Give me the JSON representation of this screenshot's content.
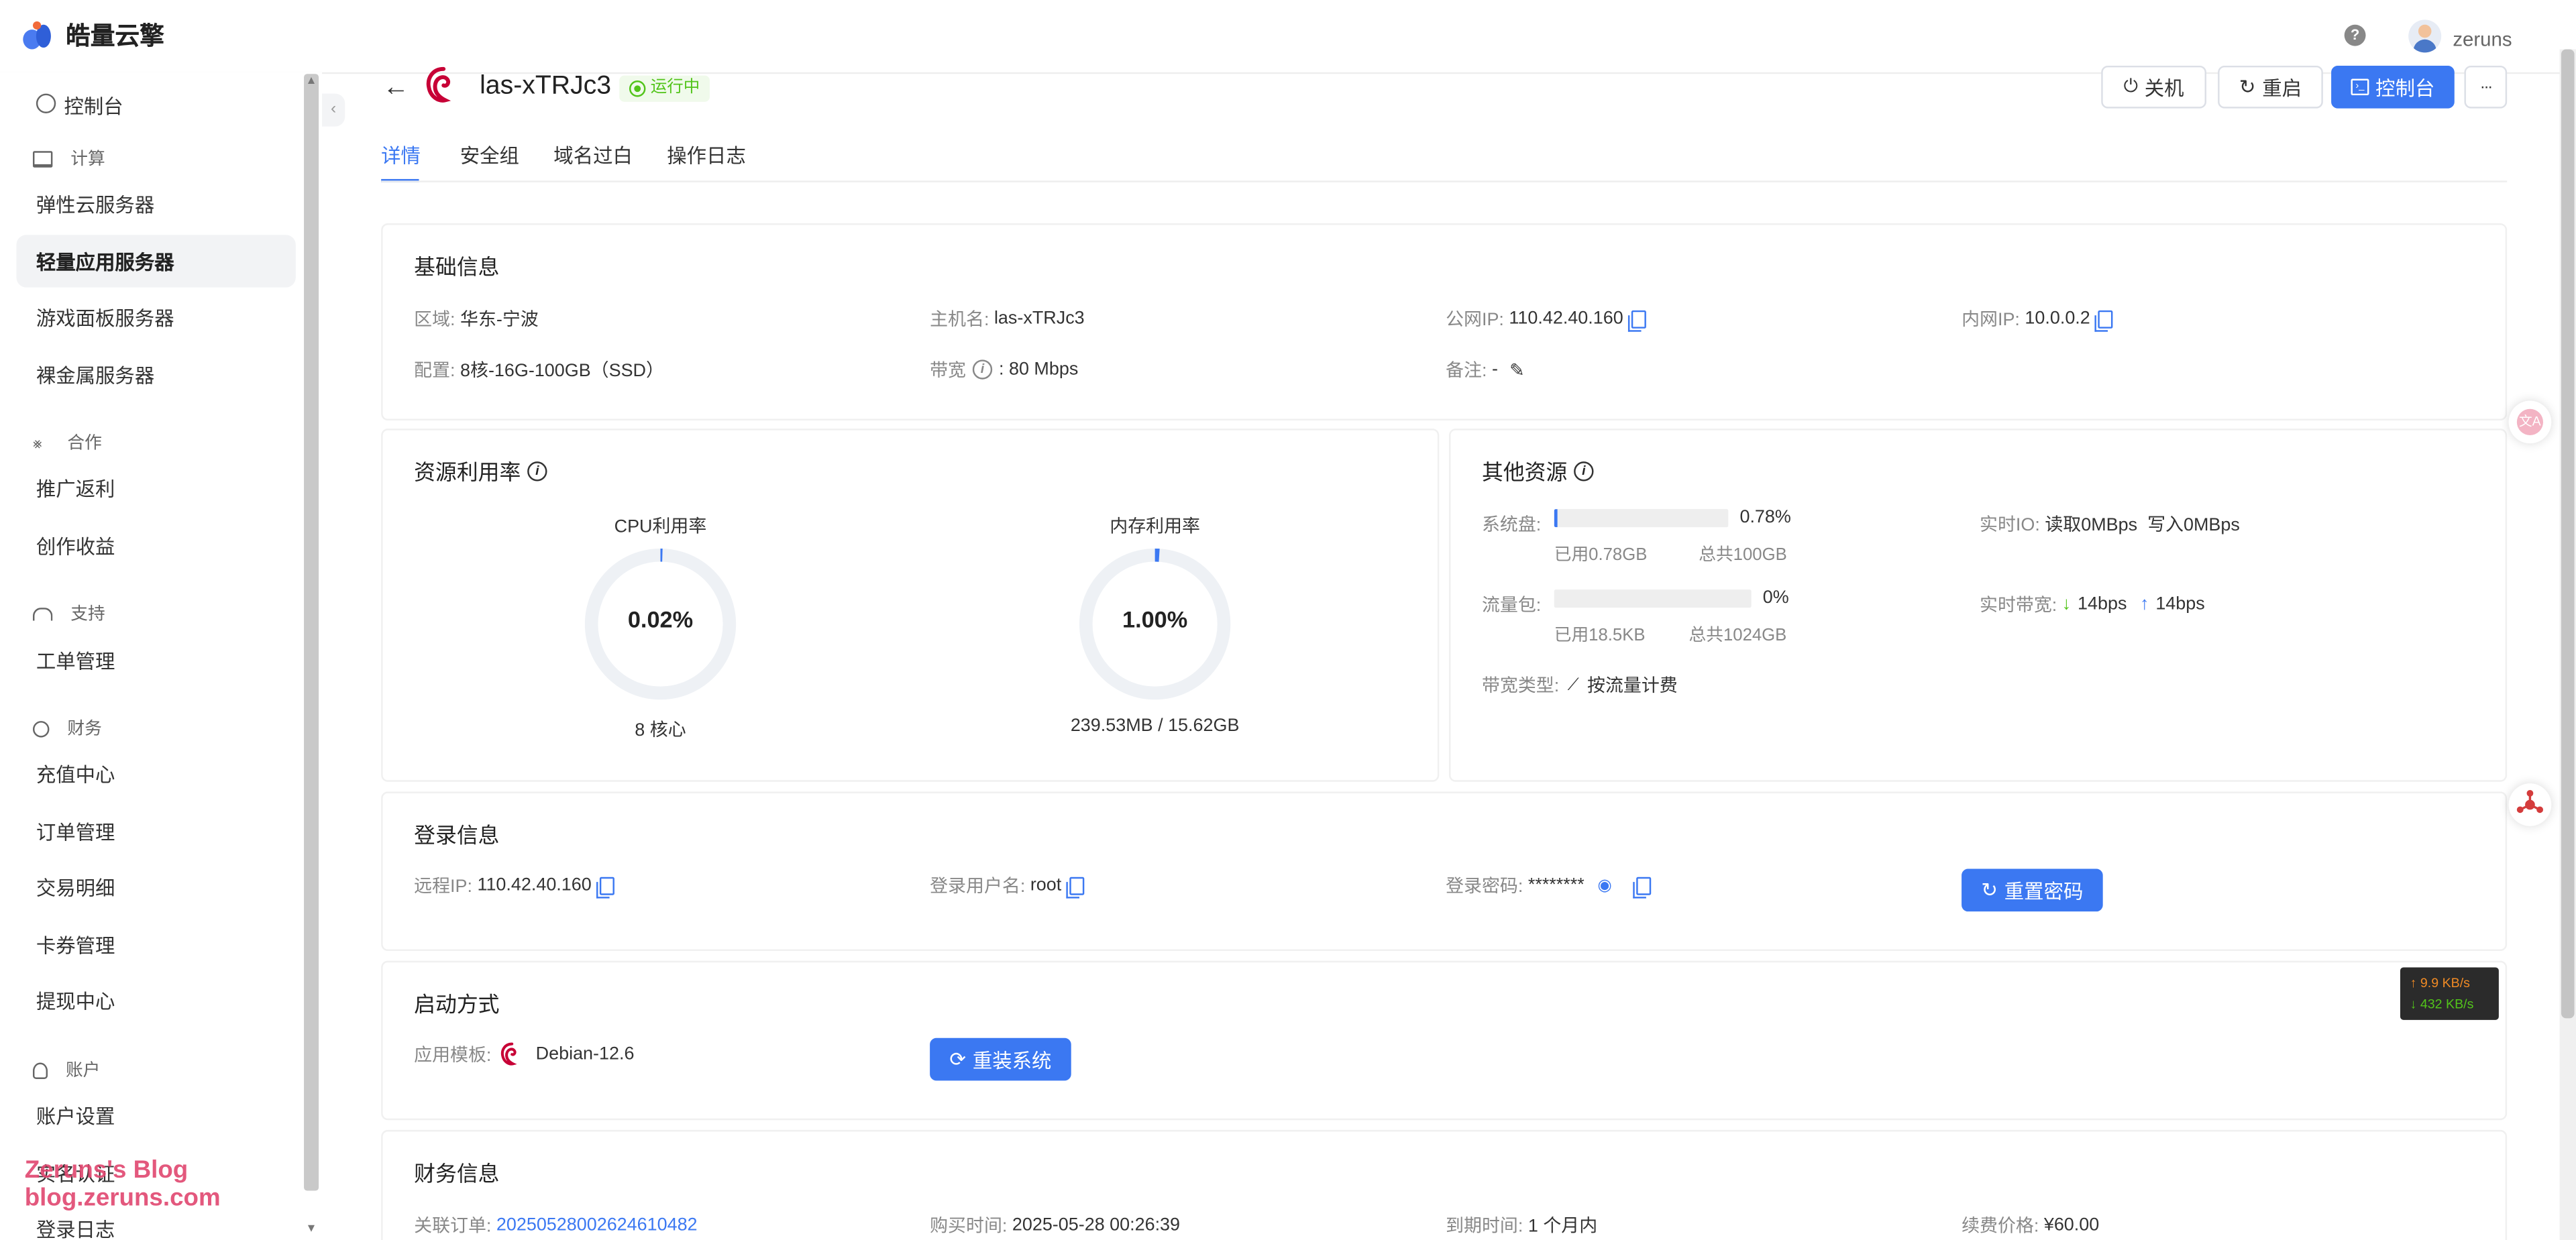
{
  "app": {
    "name": "皓量云擎"
  },
  "header": {
    "help_label": "?",
    "username": "zeruns"
  },
  "sidebar": {
    "items": [
      {
        "label": "控制台"
      },
      {
        "group": "计算"
      },
      {
        "label": "弹性云服务器"
      },
      {
        "label": "轻量应用服务器",
        "active": true
      },
      {
        "label": "游戏面板服务器"
      },
      {
        "label": "裸金属服务器"
      },
      {
        "group": "合作"
      },
      {
        "label": "推广返利"
      },
      {
        "label": "创作收益"
      },
      {
        "group": "支持"
      },
      {
        "label": "工单管理"
      },
      {
        "group": "财务"
      },
      {
        "label": "充值中心"
      },
      {
        "label": "订单管理"
      },
      {
        "label": "交易明细"
      },
      {
        "label": "卡券管理"
      },
      {
        "label": "提现中心"
      },
      {
        "group": "账户"
      },
      {
        "label": "账户设置"
      },
      {
        "label": "实名认证"
      },
      {
        "label": "登录日志"
      }
    ],
    "watermark": [
      "Zeruns's Blog",
      "blog.zeruns.com"
    ]
  },
  "instance": {
    "name": "las-xTRJc3",
    "status": "运行中",
    "actions": {
      "shutdown": "关机",
      "restart": "重启",
      "console": "控制台",
      "more": "···"
    }
  },
  "tabs": [
    "详情",
    "安全组",
    "域名过白",
    "操作日志"
  ],
  "basic": {
    "title": "基础信息",
    "region_label": "区域:",
    "region": "华东-宁波",
    "hostname_label": "主机名:",
    "hostname": "las-xTRJc3",
    "public_ip_label": "公网IP:",
    "public_ip": "110.42.40.160",
    "private_ip_label": "内网IP:",
    "private_ip": "10.0.0.2",
    "config_label": "配置:",
    "config": "8核-16G-100GB（SSD）",
    "bandwidth_label": "带宽",
    "bandwidth": "80 Mbps",
    "note_label": "备注:",
    "note": "-"
  },
  "usage": {
    "title": "资源利用率",
    "cpu": {
      "label": "CPU利用率",
      "value": "0.02%",
      "pct": 0.02,
      "sub": "8 核心"
    },
    "mem": {
      "label": "内存利用率",
      "value": "1.00%",
      "pct": 1.0,
      "sub": "239.53MB / 15.62GB"
    }
  },
  "other": {
    "title": "其他资源",
    "disk": {
      "label": "系统盘:",
      "pct_text": "0.78%",
      "pct": 0.78,
      "used": "已用0.78GB",
      "total": "总共100GB"
    },
    "traffic": {
      "label": "流量包:",
      "pct_text": "0%",
      "pct": 0,
      "used": "已用18.5KB",
      "total": "总共1024GB"
    },
    "bw_type_label": "带宽类型:",
    "bw_type": "按流量计费",
    "io_label": "实时IO:",
    "io_read": "读取0MBps",
    "io_write": "写入0MBps",
    "rt_bw_label": "实时带宽:",
    "rt_down": "14bps",
    "rt_up": "14bps"
  },
  "login": {
    "title": "登录信息",
    "remote_ip_label": "远程IP:",
    "remote_ip": "110.42.40.160",
    "user_label": "登录用户名:",
    "user": "root",
    "pwd_label": "登录密码:",
    "pwd": "********",
    "reset_btn": "重置密码"
  },
  "boot": {
    "title": "启动方式",
    "tpl_label": "应用模板:",
    "tpl": "Debian-12.6",
    "reinstall_btn": "重装系统"
  },
  "finance": {
    "title": "财务信息",
    "order_label": "关联订单:",
    "order": "20250528002624610482",
    "buy_label": "购买时间:",
    "buy": "2025-05-28 00:26:39",
    "expire_label": "到期时间:",
    "expire": "1 个月内",
    "renew_label": "续费价格:",
    "renew": "¥60.00"
  },
  "speed_widget": {
    "up": "↑ 9.9 KB/s",
    "down": "↓ 432 KB/s"
  },
  "colors": {
    "primary": "#3b78f2",
    "success": "#52c41a",
    "brand_pink": "#e0466f"
  }
}
